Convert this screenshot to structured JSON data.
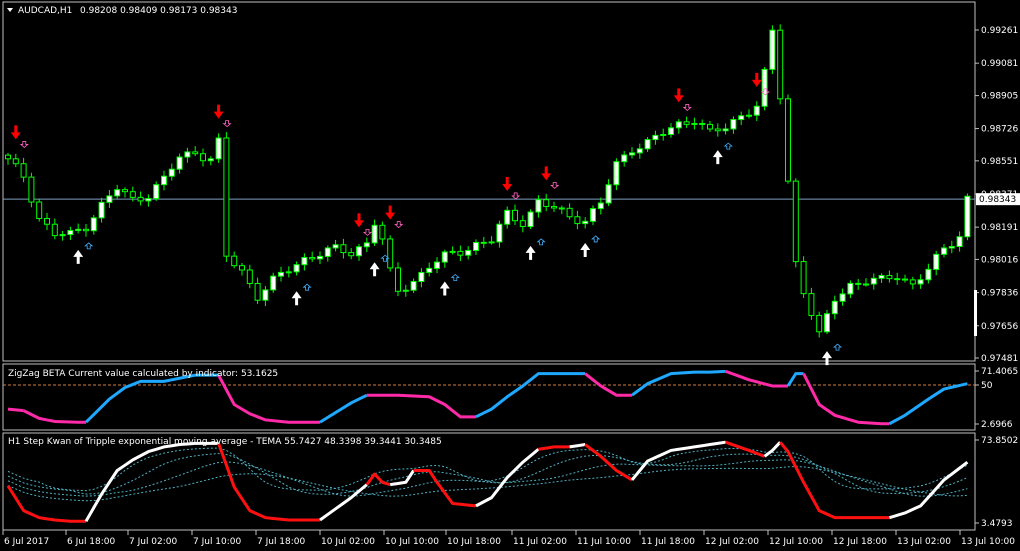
{
  "main": {
    "symbol_label": "AUDCAD,H1",
    "ohlc_label": "0.98208 0.98409 0.98173 0.98343",
    "current_price_label": "0.98343",
    "current_price": 0.98343,
    "price_range": [
      0.97481,
      0.993
    ],
    "price_ticks": [
      "0.99261",
      "0.99081",
      "0.98905",
      "0.98726",
      "0.98551",
      "0.98371",
      "0.98191",
      "0.98016",
      "0.97836",
      "0.97656",
      "0.97481"
    ]
  },
  "zigzag": {
    "title": "ZigZag BETA  Current value calculated by indicator: 53.1625",
    "level_label": "50",
    "ticks": [
      "71.4065",
      "50",
      "2.6966"
    ]
  },
  "tema": {
    "title": "H1 Step Kwan of Tripple exponential moving average - TEMA 55.7427 48.3398 39.3441 30.3485",
    "ticks": [
      "73.8502",
      "3.4793"
    ]
  },
  "time_axis": [
    "6 Jul 2017",
    "6 Jul 18:00",
    "7 Jul 02:00",
    "7 Jul 10:00",
    "7 Jul 18:00",
    "10 Jul 02:00",
    "10 Jul 10:00",
    "10 Jul 18:00",
    "11 Jul 02:00",
    "11 Jul 10:00",
    "11 Jul 18:00",
    "12 Jul 02:00",
    "12 Jul 10:00",
    "12 Jul 18:00",
    "13 Jul 02:00",
    "13 Jul 10:00"
  ],
  "colors": {
    "background": "#000000",
    "frame": "#c0c0c0",
    "bull_candle": "#ffffff",
    "bear_candle": "#000000",
    "wick": "#00ff00",
    "red_arrow": "#ff0000",
    "white_arrow": "#ffffff",
    "zigzag_up": "#1ea8ff",
    "zigzag_down": "#ff2aa8",
    "tema_up": "#ffffff",
    "tema_down": "#ff1010",
    "bands": "#4fb0c0",
    "level": "#d08040"
  },
  "chart_data": [
    {
      "type": "candlestick",
      "title": "AUDCAD,H1",
      "anchors": [
        [
          0,
          0.9855
        ],
        [
          2,
          0.9847
        ],
        [
          4,
          0.9824
        ],
        [
          6,
          0.9815
        ],
        [
          8,
          0.9815
        ],
        [
          10,
          0.982
        ],
        [
          12,
          0.9831
        ],
        [
          14,
          0.984
        ],
        [
          16,
          0.9834
        ],
        [
          18,
          0.9837
        ],
        [
          20,
          0.9845
        ],
        [
          22,
          0.9857
        ],
        [
          24,
          0.986
        ],
        [
          26,
          0.9856
        ],
        [
          27,
          0.9865
        ],
        [
          28,
          0.9803
        ],
        [
          30,
          0.9795
        ],
        [
          32,
          0.9782
        ],
        [
          34,
          0.979
        ],
        [
          36,
          0.9796
        ],
        [
          38,
          0.9802
        ],
        [
          40,
          0.9805
        ],
        [
          42,
          0.9807
        ],
        [
          44,
          0.9805
        ],
        [
          46,
          0.9811
        ],
        [
          47,
          0.9822
        ],
        [
          48,
          0.9812
        ],
        [
          49,
          0.9794
        ],
        [
          50,
          0.9784
        ],
        [
          52,
          0.979
        ],
        [
          54,
          0.9798
        ],
        [
          56,
          0.9803
        ],
        [
          58,
          0.9806
        ],
        [
          60,
          0.981
        ],
        [
          62,
          0.9812
        ],
        [
          64,
          0.9826
        ],
        [
          66,
          0.9822
        ],
        [
          67,
          0.9827
        ],
        [
          68,
          0.9833
        ],
        [
          70,
          0.9829
        ],
        [
          72,
          0.9825
        ],
        [
          74,
          0.9823
        ],
        [
          76,
          0.9832
        ],
        [
          78,
          0.9853
        ],
        [
          80,
          0.9862
        ],
        [
          82,
          0.9865
        ],
        [
          84,
          0.987
        ],
        [
          86,
          0.9875
        ],
        [
          88,
          0.9878
        ],
        [
          90,
          0.987
        ],
        [
          92,
          0.9873
        ],
        [
          94,
          0.988
        ],
        [
          96,
          0.9885
        ],
        [
          97,
          0.9902
        ],
        [
          98,
          0.9925
        ],
        [
          99,
          0.989
        ],
        [
          100,
          0.9844
        ],
        [
          101,
          0.98
        ],
        [
          102,
          0.9785
        ],
        [
          104,
          0.976
        ],
        [
          106,
          0.978
        ],
        [
          108,
          0.9788
        ],
        [
          110,
          0.979
        ],
        [
          112,
          0.979
        ],
        [
          114,
          0.9793
        ],
        [
          116,
          0.9788
        ],
        [
          118,
          0.9796
        ],
        [
          120,
          0.9807
        ],
        [
          122,
          0.9815
        ],
        [
          123,
          0.9835
        ]
      ],
      "signals_down": [
        1,
        27,
        45,
        49,
        64,
        69,
        86,
        96
      ],
      "signals_up": [
        9,
        37,
        47,
        56,
        67,
        74,
        91,
        105
      ],
      "ylim": [
        0.97481,
        0.993
      ],
      "yticks": [
        0.99261,
        0.99081,
        0.98905,
        0.98726,
        0.98551,
        0.98371,
        0.98191,
        0.98016,
        0.97836,
        0.97656,
        0.97481
      ],
      "last_price": 0.98343
    },
    {
      "type": "line",
      "title": "ZigZag BETA",
      "ylim": [
        2.6966,
        71.4065
      ],
      "level": 50,
      "anchors": [
        [
          0,
          22
        ],
        [
          2,
          20
        ],
        [
          4,
          10
        ],
        [
          6,
          6
        ],
        [
          9,
          5
        ],
        [
          10,
          5
        ],
        [
          13,
          35
        ],
        [
          15,
          50
        ],
        [
          17,
          58
        ],
        [
          18,
          58
        ],
        [
          20,
          58
        ],
        [
          22,
          62
        ],
        [
          24,
          66
        ],
        [
          26,
          66
        ],
        [
          27,
          66
        ],
        [
          29,
          28
        ],
        [
          31,
          16
        ],
        [
          33,
          8
        ],
        [
          36,
          5
        ],
        [
          40,
          5
        ],
        [
          44,
          30
        ],
        [
          46,
          40
        ],
        [
          48,
          40
        ],
        [
          50,
          40
        ],
        [
          54,
          38
        ],
        [
          56,
          28
        ],
        [
          58,
          12
        ],
        [
          60,
          12
        ],
        [
          62,
          22
        ],
        [
          64,
          38
        ],
        [
          66,
          52
        ],
        [
          68,
          68
        ],
        [
          70,
          68
        ],
        [
          74,
          68
        ],
        [
          76,
          52
        ],
        [
          78,
          40
        ],
        [
          80,
          40
        ],
        [
          82,
          55
        ],
        [
          85,
          68
        ],
        [
          88,
          70
        ],
        [
          90,
          70
        ],
        [
          92,
          71
        ],
        [
          95,
          60
        ],
        [
          98,
          52
        ],
        [
          100,
          52
        ],
        [
          101,
          68
        ],
        [
          102,
          68
        ],
        [
          104,
          28
        ],
        [
          106,
          14
        ],
        [
          109,
          5
        ],
        [
          112,
          3
        ],
        [
          113,
          3
        ],
        [
          115,
          14
        ],
        [
          118,
          35
        ],
        [
          120,
          48
        ],
        [
          123,
          55
        ]
      ],
      "segments": [
        {
          "from": 0,
          "to": 2,
          "direction": "down"
        },
        {
          "from": 2,
          "to": 10,
          "direction": "down"
        },
        {
          "from": 10,
          "to": 27,
          "direction": "up"
        },
        {
          "from": 27,
          "to": 40,
          "direction": "down"
        },
        {
          "from": 40,
          "to": 46,
          "direction": "up"
        },
        {
          "from": 46,
          "to": 60,
          "direction": "down"
        },
        {
          "from": 60,
          "to": 74,
          "direction": "up"
        },
        {
          "from": 74,
          "to": 80,
          "direction": "down"
        },
        {
          "from": 80,
          "to": 92,
          "direction": "up"
        },
        {
          "from": 92,
          "to": 100,
          "direction": "down"
        },
        {
          "from": 100,
          "to": 102,
          "direction": "up"
        },
        {
          "from": 102,
          "to": 113,
          "direction": "down"
        },
        {
          "from": 113,
          "to": 123,
          "direction": "up"
        }
      ]
    },
    {
      "type": "line",
      "title": "TEMA",
      "ylim": [
        3.4793,
        73.8502
      ],
      "series_values_last": [
        55.7427,
        48.3398,
        39.3441,
        30.3485
      ],
      "anchors": [
        [
          0,
          35
        ],
        [
          2,
          14
        ],
        [
          4,
          8
        ],
        [
          6,
          6
        ],
        [
          8,
          5
        ],
        [
          10,
          5
        ],
        [
          12,
          28
        ],
        [
          14,
          48
        ],
        [
          16,
          57
        ],
        [
          18,
          64
        ],
        [
          20,
          68
        ],
        [
          22,
          70
        ],
        [
          24,
          71
        ],
        [
          26,
          71
        ],
        [
          27,
          71
        ],
        [
          29,
          34
        ],
        [
          31,
          14
        ],
        [
          33,
          8
        ],
        [
          36,
          6
        ],
        [
          40,
          6
        ],
        [
          44,
          25
        ],
        [
          46,
          36
        ],
        [
          47,
          45
        ],
        [
          48,
          38
        ],
        [
          49,
          36
        ],
        [
          51,
          38
        ],
        [
          52,
          48
        ],
        [
          54,
          48
        ],
        [
          55,
          38
        ],
        [
          57,
          20
        ],
        [
          60,
          18
        ],
        [
          62,
          25
        ],
        [
          64,
          42
        ],
        [
          66,
          55
        ],
        [
          68,
          66
        ],
        [
          70,
          68
        ],
        [
          72,
          68
        ],
        [
          74,
          70
        ],
        [
          76,
          60
        ],
        [
          78,
          48
        ],
        [
          80,
          40
        ],
        [
          82,
          56
        ],
        [
          85,
          65
        ],
        [
          88,
          68
        ],
        [
          90,
          70
        ],
        [
          92,
          72
        ],
        [
          95,
          65
        ],
        [
          97,
          60
        ],
        [
          98,
          65
        ],
        [
          99,
          72
        ],
        [
          100,
          64
        ],
        [
          102,
          38
        ],
        [
          104,
          14
        ],
        [
          106,
          8
        ],
        [
          110,
          8
        ],
        [
          113,
          8
        ],
        [
          115,
          12
        ],
        [
          117,
          18
        ],
        [
          120,
          40
        ],
        [
          123,
          55
        ]
      ],
      "segments": [
        {
          "from": 0,
          "to": 10,
          "direction": "down"
        },
        {
          "from": 10,
          "to": 27,
          "direction": "up"
        },
        {
          "from": 27,
          "to": 40,
          "direction": "down"
        },
        {
          "from": 40,
          "to": 46,
          "direction": "up"
        },
        {
          "from": 46,
          "to": 49,
          "direction": "down"
        },
        {
          "from": 49,
          "to": 52,
          "direction": "up"
        },
        {
          "from": 52,
          "to": 60,
          "direction": "down"
        },
        {
          "from": 60,
          "to": 68,
          "direction": "up"
        },
        {
          "from": 68,
          "to": 72,
          "direction": "down"
        },
        {
          "from": 72,
          "to": 74,
          "direction": "up"
        },
        {
          "from": 74,
          "to": 80,
          "direction": "down"
        },
        {
          "from": 80,
          "to": 92,
          "direction": "up"
        },
        {
          "from": 92,
          "to": 97,
          "direction": "down"
        },
        {
          "from": 97,
          "to": 99,
          "direction": "up"
        },
        {
          "from": 99,
          "to": 113,
          "direction": "down"
        },
        {
          "from": 113,
          "to": 123,
          "direction": "up"
        }
      ]
    }
  ]
}
